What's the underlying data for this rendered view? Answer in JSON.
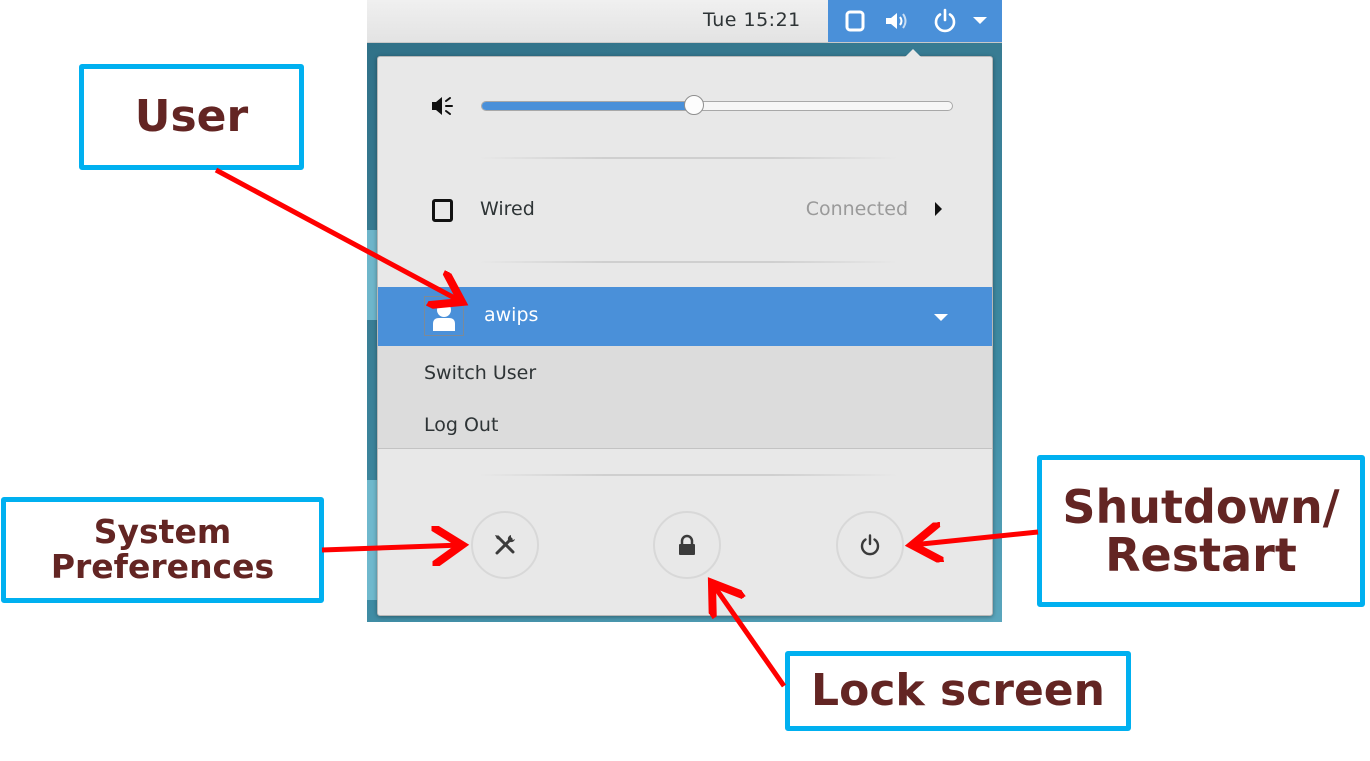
{
  "topbar": {
    "clock": "Tue 15:21",
    "status_icons": [
      "network-wired-icon",
      "volume-icon",
      "power-icon",
      "dropdown-arrow-icon"
    ]
  },
  "menu": {
    "volume": {
      "icon": "speaker-icon",
      "level_percent": 45
    },
    "network": {
      "icon": "wired-network-icon",
      "label": "Wired",
      "status": "Connected",
      "submenu_indicator": "chevron-right-icon"
    },
    "user": {
      "icon": "user-avatar-icon",
      "name": "awips",
      "expanded": true,
      "expander": "chevron-down-icon"
    },
    "user_submenu": [
      "Switch User",
      "Log Out"
    ],
    "action_buttons": [
      {
        "icon": "settings-tools-icon",
        "purpose": "System Preferences"
      },
      {
        "icon": "lock-icon",
        "purpose": "Lock screen"
      },
      {
        "icon": "power-icon",
        "purpose": "Shutdown/Restart"
      }
    ]
  },
  "annotations": {
    "user": "User",
    "system_preferences_line1": "System",
    "system_preferences_line2": "Preferences",
    "shutdown_line1": "Shutdown/",
    "shutdown_line2": "Restart",
    "lock_screen": "Lock screen"
  },
  "colors": {
    "accent": "#4a90d9",
    "callout_border": "#00b0f0",
    "callout_text": "#632523",
    "arrow": "#ff0000",
    "menu_bg": "#e8e8e8"
  }
}
